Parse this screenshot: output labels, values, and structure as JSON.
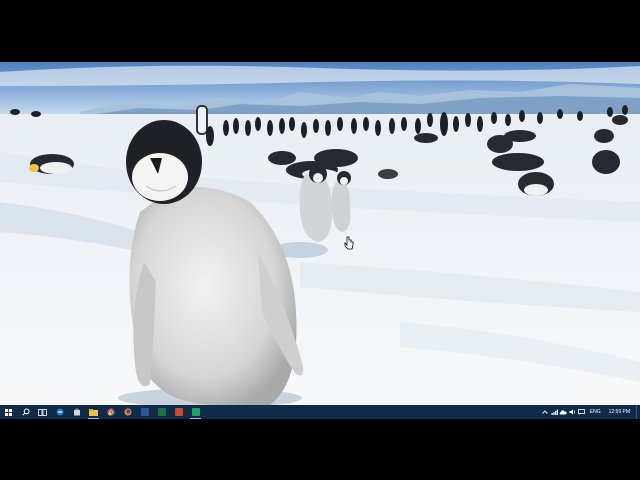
{
  "desktop": {
    "wallpaper": "emperor-penguins-on-ice",
    "taskbar": {
      "color": "#102a4a",
      "start_icon": "windows-logo-icon",
      "search_icon": "search-icon",
      "task_view_icon": "task-view-icon",
      "pinned_apps": [
        {
          "name": "edge-icon",
          "color": "#1f7ad6",
          "active": false
        },
        {
          "name": "store-icon",
          "color": "#d0d6de",
          "active": false
        },
        {
          "name": "file-explorer-icon",
          "color": "#f3c241",
          "active": true
        },
        {
          "name": "chrome-icon",
          "color": "#e8453c",
          "active": false
        },
        {
          "name": "firefox-icon",
          "color": "#f08a24",
          "active": false
        },
        {
          "name": "word-icon",
          "color": "#2b5797",
          "active": false
        },
        {
          "name": "excel-icon",
          "color": "#1e7145",
          "active": false
        },
        {
          "name": "powerpoint-icon",
          "color": "#d24726",
          "active": false
        },
        {
          "name": "excel-window-icon",
          "color": "#21a366",
          "active": true
        }
      ],
      "tray": {
        "language": "ENG",
        "time": "12:59 PM"
      }
    }
  }
}
